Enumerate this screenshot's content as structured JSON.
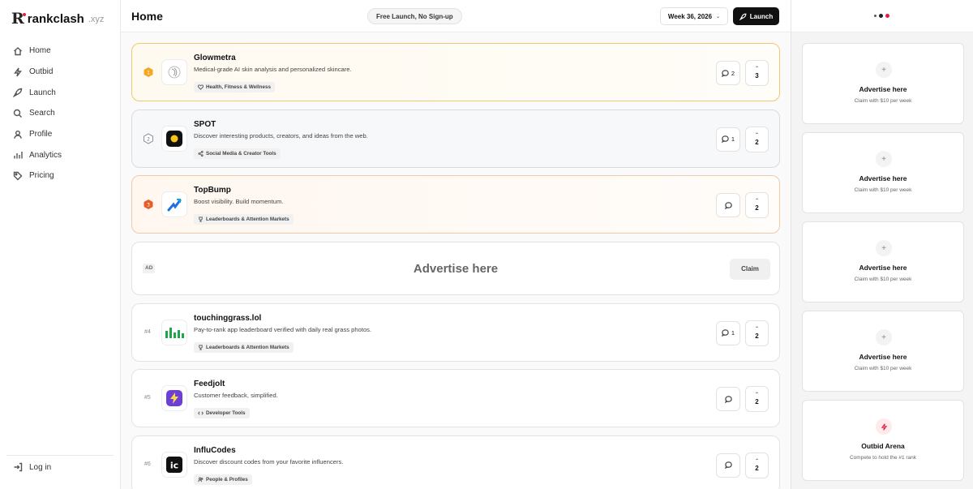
{
  "brand": {
    "mark": "R",
    "name": "rankclash",
    "tld": ".xyz"
  },
  "nav": [
    {
      "label": "Home",
      "icon": "home-icon"
    },
    {
      "label": "Outbid",
      "icon": "bolt-icon"
    },
    {
      "label": "Launch",
      "icon": "rocket-icon"
    },
    {
      "label": "Search",
      "icon": "search-icon"
    },
    {
      "label": "Profile",
      "icon": "user-icon"
    },
    {
      "label": "Analytics",
      "icon": "bar-chart-icon"
    },
    {
      "label": "Pricing",
      "icon": "tag-icon"
    }
  ],
  "login": {
    "label": "Log in"
  },
  "header": {
    "title": "Home",
    "pill": "Free Launch, No Sign-up",
    "week": "Week 36, 2026",
    "launch": "Launch"
  },
  "products": [
    {
      "rank": "1",
      "medal": "gold",
      "name": "Glowmetra",
      "desc": "Medical-grade AI skin analysis and personalized skincare.",
      "tag": "Health, Fitness & Wellness",
      "comments": "2",
      "votes": "3"
    },
    {
      "rank": "2",
      "medal": "silver",
      "name": "SPOT",
      "desc": "Discover interesting products, creators, and ideas from the web.",
      "tag": "Social Media & Creator Tools",
      "comments": "1",
      "votes": "2"
    },
    {
      "rank": "3",
      "medal": "bronze",
      "name": "TopBump",
      "desc": "Boost visibility. Build momentum.",
      "tag": "Leaderboards & Attention Markets",
      "comments": "",
      "votes": "2"
    }
  ],
  "ad_slot": {
    "label": "AD",
    "title": "Advertise here",
    "claim": "Claim"
  },
  "more_products": [
    {
      "rank": "#4",
      "name": "touchinggrass.lol",
      "desc": "Pay-to-rank app leaderboard verified with daily real grass photos.",
      "tag": "Leaderboards & Attention Markets",
      "comments": "1",
      "votes": "2"
    },
    {
      "rank": "#5",
      "name": "Feedjolt",
      "desc": "Customer feedback, simplified.",
      "tag": "Developer Tools",
      "comments": "",
      "votes": "2"
    },
    {
      "rank": "#6",
      "name": "InfluCodes",
      "desc": "Discover discount codes from your favorite influencers.",
      "tag": "People & Profiles",
      "comments": "",
      "votes": "2"
    }
  ],
  "right_ads": [
    {
      "title": "Advertise here",
      "sub": "Claim with $10 per week"
    },
    {
      "title": "Advertise here",
      "sub": "Claim with $10 per week"
    },
    {
      "title": "Advertise here",
      "sub": "Claim with $10 per week"
    },
    {
      "title": "Advertise here",
      "sub": "Claim with $10 per week"
    }
  ],
  "arena": {
    "title": "Outbid Arena",
    "sub": "Compete to hold the #1 rank"
  },
  "colors": {
    "accent": "#e11d48",
    "gold": "#f5a623",
    "silver": "#9aa3ad",
    "bronze": "#e4602a"
  }
}
